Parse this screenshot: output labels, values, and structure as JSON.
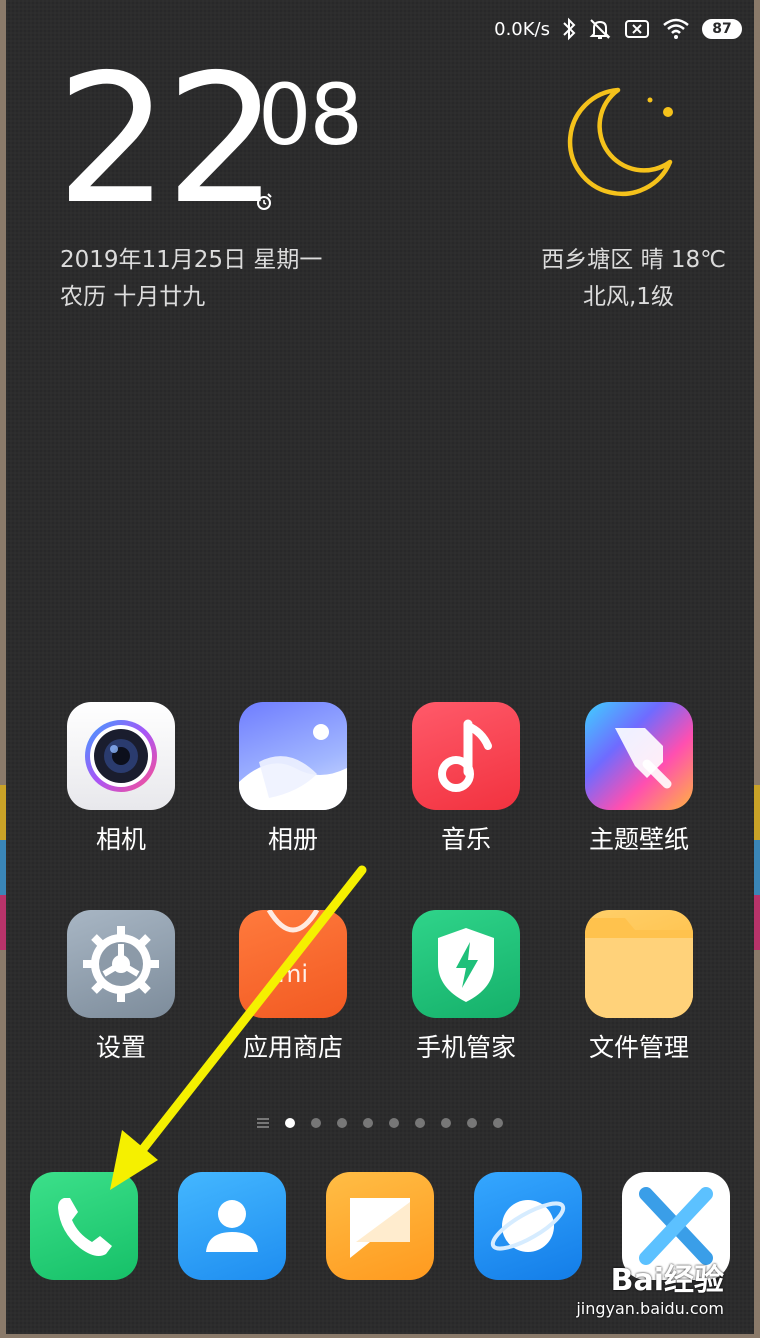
{
  "status_bar": {
    "net_speed": "0.0K/s",
    "battery": "87",
    "icons": [
      "bluetooth-icon",
      "mute-icon",
      "no-sim-icon",
      "wifi-icon",
      "battery-icon"
    ]
  },
  "clock": {
    "hour": "22",
    "minute": "08"
  },
  "date": {
    "gregorian": "2019年11月25日 星期一",
    "lunar": "农历 十月廿九"
  },
  "weather": {
    "line1": "西乡塘区   晴   18℃",
    "line2": "北风,1级",
    "icon": "moon-icon",
    "accent": "#f5c21b"
  },
  "apps": [
    {
      "label": "相机",
      "icon": "camera-icon"
    },
    {
      "label": "相册",
      "icon": "gallery-icon"
    },
    {
      "label": "音乐",
      "icon": "music-icon"
    },
    {
      "label": "主题壁纸",
      "icon": "theme-icon"
    },
    {
      "label": "设置",
      "icon": "settings-icon"
    },
    {
      "label": "应用商店",
      "icon": "app-store-icon"
    },
    {
      "label": "手机管家",
      "icon": "security-icon"
    },
    {
      "label": "文件管理",
      "icon": "file-manager-icon"
    }
  ],
  "page_indicator": {
    "count": 9,
    "active": 1
  },
  "dock": [
    {
      "icon": "phone-icon"
    },
    {
      "icon": "contacts-icon"
    },
    {
      "icon": "messages-icon"
    },
    {
      "icon": "browser-icon"
    },
    {
      "icon": "x-app-icon"
    }
  ],
  "annotation": {
    "type": "arrow",
    "color": "#f5f000",
    "target": "phone-icon"
  },
  "watermark": {
    "logo": "Bai经验",
    "url": "jingyan.baidu.com"
  }
}
